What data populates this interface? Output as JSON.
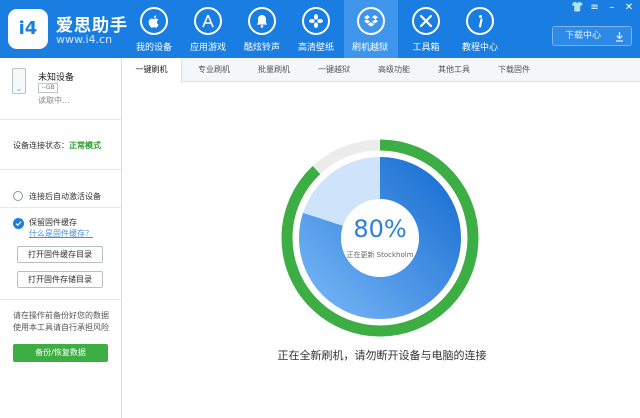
{
  "app": {
    "brand_name": "爱思助手",
    "brand_badge": "i4",
    "brand_url": "www.i4.cn"
  },
  "colors": {
    "header_blue": "#1a7de2",
    "active_green": "#2a9d2f",
    "progress_green": "#3dae44",
    "progress_blue": "#2f7fd6"
  },
  "nav": {
    "items": [
      {
        "label": "我的设备",
        "icon": "apple-icon"
      },
      {
        "label": "应用游戏",
        "icon": "app-store-icon"
      },
      {
        "label": "酷炫铃声",
        "icon": "bell-icon"
      },
      {
        "label": "高清壁纸",
        "icon": "flower-icon"
      },
      {
        "label": "刷机越狱",
        "icon": "dropbox-icon",
        "active": true
      },
      {
        "label": "工具箱",
        "icon": "tools-icon"
      },
      {
        "label": "教程中心",
        "icon": "info-icon"
      }
    ]
  },
  "window_controls": [
    "shirt-icon",
    "menu-icon",
    "minimize-icon",
    "close-icon"
  ],
  "window_glyphs": {
    "shirt": "👕",
    "menu": "≡",
    "minimize": "–",
    "close": "✕"
  },
  "download_center": {
    "label": "下载中心",
    "icon": "download-icon"
  },
  "device": {
    "name": "未知设备",
    "storage": "--GB",
    "status": "读取中..."
  },
  "connection": {
    "label": "设备连接状态：",
    "value": "正常模式"
  },
  "auto_activate": {
    "label": "连接后自动激活设备"
  },
  "firmware_cache": {
    "label": "保留固件缓存",
    "link": "什么是固件缓存？",
    "open_cache_dir": "打开固件缓存目录",
    "open_storage_dir": "打开固件存储目录"
  },
  "backup": {
    "warning": "请在操作前备份好您的数据使用本工具请自行承担风险",
    "button": "备份/恢复数据"
  },
  "tabs": [
    {
      "label": "一键刷机",
      "active": true
    },
    {
      "label": "专业刷机"
    },
    {
      "label": "批量刷机"
    },
    {
      "label": "一键越狱"
    },
    {
      "label": "高级功能"
    },
    {
      "label": "其他工具"
    },
    {
      "label": "下载固件"
    }
  ],
  "progress": {
    "percent_label": "80%",
    "value": 0.8,
    "status": "正在更新 Stockholm",
    "message": "正在全新刷机，请勿断开设备与电脑的连接"
  }
}
